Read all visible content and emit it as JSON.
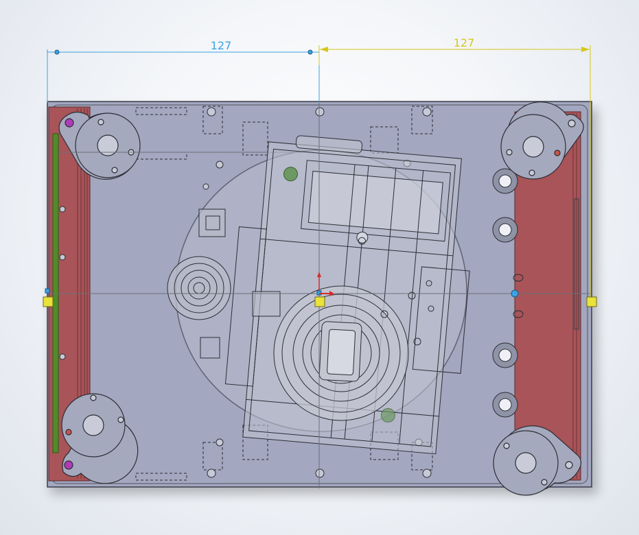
{
  "viewport": {
    "background": "#eef1f5"
  },
  "dimensions": [
    {
      "id": "left-dimension",
      "value": "127",
      "color": "#3aa3e3"
    },
    {
      "id": "right-dimension",
      "value": "127",
      "color": "#d6c71b"
    }
  ],
  "colors": {
    "plate": "#a3a7bf",
    "plate_edge": "#3a3d4a",
    "rail": "#a85458",
    "rail_dark": "#7e3c3f",
    "green_strip": "#4f8c2a",
    "purple_dot": "#b03ab8",
    "camera_fill": "#bfc3cd",
    "line_dark": "#2b2d35",
    "axis_line": "#6c6f78",
    "marker_yellow": "#e8e23a"
  }
}
